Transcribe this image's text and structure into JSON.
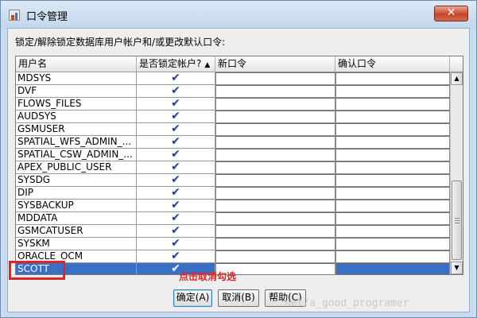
{
  "window": {
    "title": "口令管理",
    "close_symbol": "✕"
  },
  "instruction": "锁定/解除锁定数据库用户帐户和/或更改默认口令:",
  "table": {
    "columns": [
      "用户名",
      "是否锁定帐户?",
      "新口令",
      "确认口令"
    ],
    "sort_arrow": "▲",
    "sorted_column": "是否锁定帐户?",
    "check_symbol": "✔",
    "rows": [
      {
        "user": "MDSYS",
        "locked": true
      },
      {
        "user": "DVF",
        "locked": true
      },
      {
        "user": "FLOWS_FILES",
        "locked": true
      },
      {
        "user": "AUDSYS",
        "locked": true
      },
      {
        "user": "GSMUSER",
        "locked": true
      },
      {
        "user": "SPATIAL_WFS_ADMIN_...",
        "locked": true
      },
      {
        "user": "SPATIAL_CSW_ADMIN_...",
        "locked": true
      },
      {
        "user": "APEX_PUBLIC_USER",
        "locked": true
      },
      {
        "user": "SYSDG",
        "locked": true
      },
      {
        "user": "DIP",
        "locked": true
      },
      {
        "user": "SYSBACKUP",
        "locked": true
      },
      {
        "user": "MDDATA",
        "locked": true
      },
      {
        "user": "GSMCATUSER",
        "locked": true
      },
      {
        "user": "SYSKM",
        "locked": true
      },
      {
        "user": "ORACLE_OCM",
        "locked": true
      },
      {
        "user": "SCOTT",
        "locked": true,
        "selected": true
      }
    ]
  },
  "scrollbar": {
    "up_symbol": "▲",
    "down_symbol": "▼"
  },
  "annotation": "点击取消勾选",
  "buttons": {
    "ok": "确定(A)",
    "cancel": "取消(B)",
    "help": "帮助(C)"
  },
  "watermark": "net/a_good_programer",
  "colors": {
    "selection": "#3a6fc6",
    "check": "#1d3f9c",
    "annotation": "#e32424"
  }
}
